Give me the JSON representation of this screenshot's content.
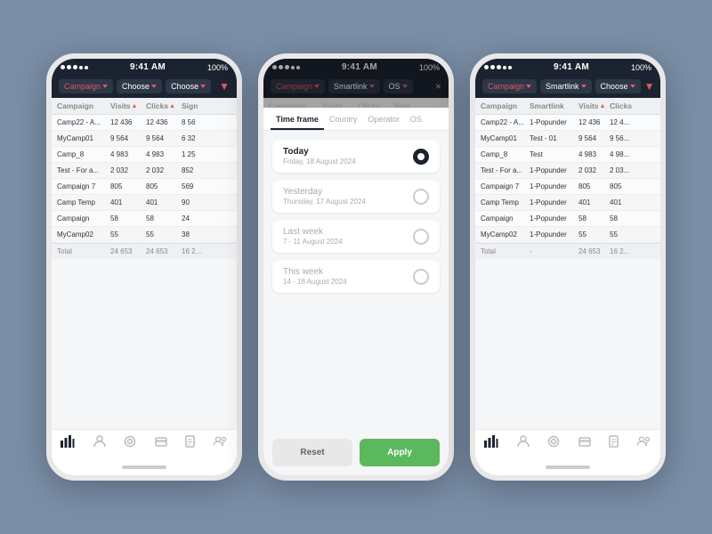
{
  "colors": {
    "background": "#7b8fa8",
    "phoneBorder": "#e8e8e8",
    "headerBg": "#1c2330",
    "accent": "#e05a5a",
    "green": "#5cb85c"
  },
  "phone1": {
    "statusBar": {
      "left": "•••••",
      "center": "9:41 AM",
      "right": "100%"
    },
    "header": {
      "dropdown1": "Campaign",
      "dropdown2": "Choose",
      "dropdown3": "Choose"
    },
    "table": {
      "columns": [
        "Campaign",
        "Visits",
        "Clicks",
        "Sign"
      ],
      "rows": [
        [
          "Camp22 - A...",
          "12 436",
          "12 436",
          "8 56"
        ],
        [
          "MyCamp01",
          "9 564",
          "9 564",
          "6 32"
        ],
        [
          "Camp_8",
          "4 983",
          "4 983",
          "1 25"
        ],
        [
          "Test - For a...",
          "2 032",
          "2 032",
          "852"
        ],
        [
          "Campaign 7",
          "805",
          "805",
          "569"
        ],
        [
          "Camp Temp",
          "401",
          "401",
          "90"
        ],
        [
          "Campaign",
          "58",
          "58",
          "24"
        ],
        [
          "MyCamp02",
          "55",
          "55",
          "38"
        ]
      ],
      "footer": [
        "Total",
        "24 653",
        "24 653",
        "16 2..."
      ]
    },
    "nav": [
      "📊",
      "👤",
      "🎯",
      "💳",
      "📄",
      "👥"
    ]
  },
  "phone2": {
    "statusBar": {
      "left": "•••••",
      "center": "9:41 AM",
      "right": "100%"
    },
    "header": {
      "dropdown1": "Campaign",
      "dropdown2": "Smartlink",
      "dropdown3": "OS",
      "close": "×"
    },
    "modal": {
      "tabs": [
        "Time frame",
        "Country",
        "Operator",
        "OS"
      ],
      "activeTab": "Time frame",
      "options": [
        {
          "label": "Today",
          "sublabel": "Friday, 18 August 2024",
          "selected": true
        },
        {
          "label": "Yesterday",
          "sublabel": "Thursday, 17 August 2024",
          "selected": false
        },
        {
          "label": "Last week",
          "sublabel": "7 - 11 August 2024",
          "selected": false
        },
        {
          "label": "This week",
          "sublabel": "14 - 18 August 2024",
          "selected": false
        }
      ],
      "resetLabel": "Reset",
      "applyLabel": "Apply"
    },
    "nav": [
      "📊",
      "👤",
      "🎯",
      "💳",
      "📄",
      "👥"
    ]
  },
  "phone3": {
    "statusBar": {
      "left": "•••••",
      "center": "9:41 AM",
      "right": "100%"
    },
    "header": {
      "dropdown1": "Campaign",
      "dropdown2": "Smartlink",
      "dropdown3": "Choose"
    },
    "table": {
      "columns": [
        "Campaign",
        "Smartlink",
        "Visits",
        "Clicks"
      ],
      "rows": [
        [
          "Camp22 - A...",
          "1-Popunder",
          "12 436",
          "12 4..."
        ],
        [
          "MyCamp01",
          "Test - 01",
          "9 564",
          "9 56..."
        ],
        [
          "Camp_8",
          "Test",
          "4 983",
          "4 98..."
        ],
        [
          "Test - For a...",
          "1-Popunder",
          "2 032",
          "2 03..."
        ],
        [
          "Campaign 7",
          "1-Popunder",
          "805",
          "805"
        ],
        [
          "Camp Temp",
          "1-Popunder",
          "401",
          "401"
        ],
        [
          "Campaign",
          "1-Popunder",
          "58",
          "58"
        ],
        [
          "MyCamp02",
          "1-Popunder",
          "55",
          "55"
        ]
      ],
      "footer": [
        "Total",
        "-",
        "24 653",
        "16 2..."
      ]
    },
    "nav": [
      "📊",
      "👤",
      "🎯",
      "💳",
      "📄",
      "👥"
    ]
  }
}
